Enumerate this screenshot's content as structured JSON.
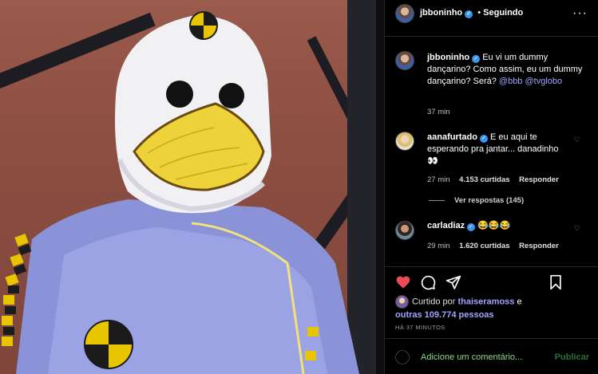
{
  "header": {
    "username": "jbboninho",
    "separator": "•",
    "follow_status": "Seguindo",
    "more_icon": "more-horizontal-icon"
  },
  "caption": {
    "username": "jbboninho",
    "text": "Eu vi um dummy dançarino? Como assim, eu um dummy dançarino? Será?",
    "mentions": [
      "@bbb",
      "@tvglobo"
    ],
    "time": "37 min"
  },
  "comments": [
    {
      "username": "aanafurtado",
      "text": "E eu aqui te esperando pra jantar... danadinho",
      "emoji": "👀",
      "time": "27 min",
      "likes": "4.153 curtidas",
      "reply": "Responder",
      "view_replies": "Ver respostas (145)"
    },
    {
      "username": "carladiaz",
      "text": "😂😂😂",
      "time": "29 min",
      "likes": "1.620 curtidas",
      "reply": "Responder"
    }
  ],
  "liked_by": {
    "prefix": "Curtido por",
    "user": "thaiseramoss",
    "conj": "e",
    "others": "outras 109.774 pessoas"
  },
  "posted_ago": "HÁ 37 MINUTOS",
  "comment_box": {
    "placeholder": "Adicione um comentário...",
    "publish": "Publicar"
  },
  "colors": {
    "background": "#000000",
    "heart_red": "#ed4956",
    "verified_blue": "#3897f0",
    "link": "#a3a3ff",
    "comment_placeholder": "#8fd68a"
  }
}
